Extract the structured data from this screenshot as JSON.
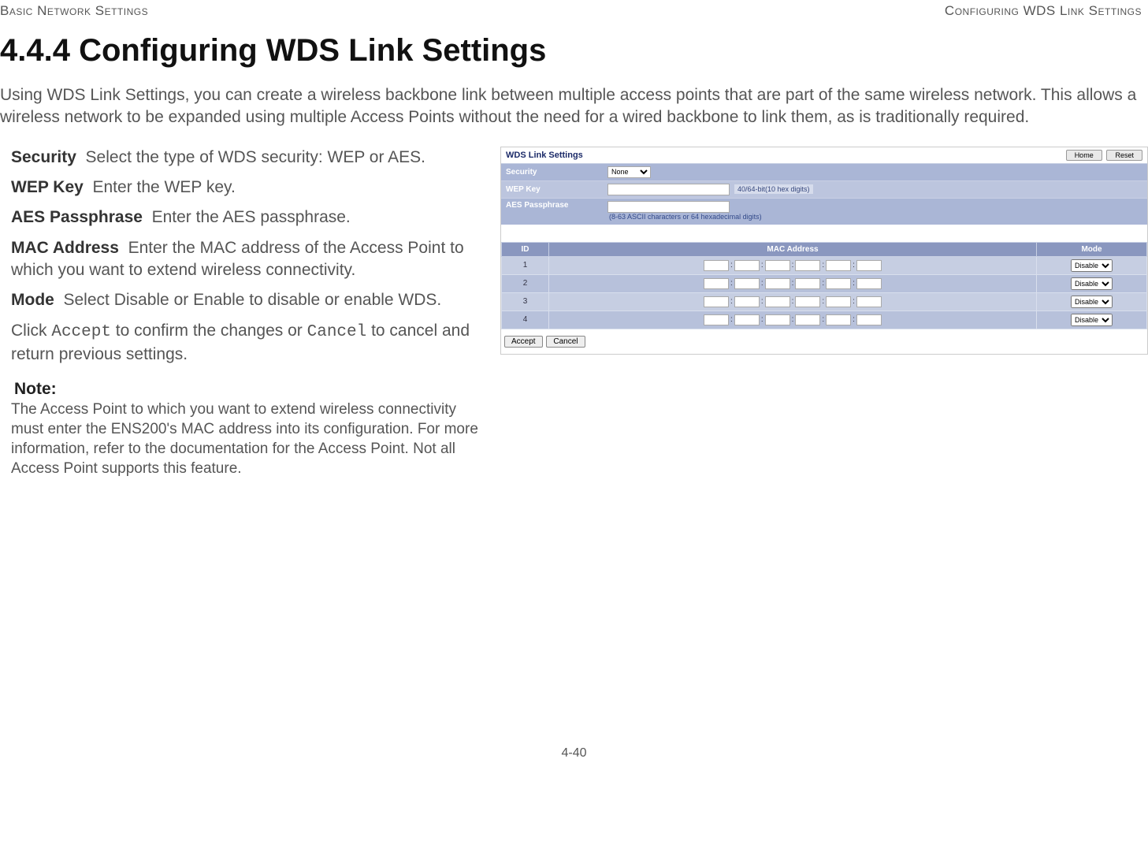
{
  "header": {
    "left": "Basic Network Settings",
    "right": "Configuring WDS Link Settings"
  },
  "heading": "4.4.4 Configuring WDS Link Settings",
  "intro": "Using WDS Link Settings, you can create a wireless backbone link between multiple access points that are part of the same wireless network. This allows a wireless network to be expanded using multiple Access Points without the need for a wired backbone to link them, as is traditionally required.",
  "fields": {
    "security": {
      "label": "Security",
      "desc": "Select the type of WDS security: WEP or AES."
    },
    "wep": {
      "label": "WEP Key",
      "desc": "Enter the WEP key."
    },
    "aes": {
      "label": "AES Passphrase",
      "desc": "Enter the AES passphrase."
    },
    "mac": {
      "label": "MAC Address",
      "desc": "Enter the MAC address of the Access Point to which you want to extend wireless connectivity."
    },
    "mode": {
      "label": "Mode",
      "desc": "Select Disable or Enable to disable or enable WDS."
    }
  },
  "action": {
    "prefix": "Click ",
    "accept": "Accept",
    "mid": " to confirm the changes or ",
    "cancel": "Cancel",
    "suffix": " to cancel and return previous settings."
  },
  "note": {
    "label": "Note:",
    "body": "The Access Point to which you want to extend wireless connectivity must enter the ENS200's MAC address into its configuration. For more information, refer to the documentation for the Access Point. Not all Access Point supports this feature."
  },
  "screenshot": {
    "title": "WDS Link Settings",
    "home_btn": "Home",
    "reset_btn": "Reset",
    "security_label": "Security",
    "security_value": "None",
    "wep_label": "WEP Key",
    "wep_hint": "40/64-bit(10 hex digits)",
    "aes_label": "AES Passphrase",
    "aes_hint": "(8-63 ASCII characters or 64 hexadecimal digits)",
    "table": {
      "id_header": "ID",
      "mac_header": "MAC Address",
      "mode_header": "Mode",
      "rows": [
        {
          "id": "1",
          "mode": "Disable"
        },
        {
          "id": "2",
          "mode": "Disable"
        },
        {
          "id": "3",
          "mode": "Disable"
        },
        {
          "id": "4",
          "mode": "Disable"
        }
      ]
    },
    "accept_btn": "Accept",
    "cancel_btn": "Cancel"
  },
  "page_number": "4-40"
}
